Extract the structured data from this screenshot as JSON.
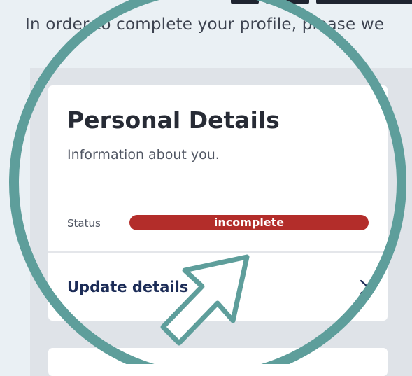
{
  "intro_text": "In order to complete your profile, please we",
  "card": {
    "title": "Personal Details",
    "subtitle": "Information about you.",
    "status_label": "Status",
    "status_value": "incomplete",
    "update_label": "Update details"
  },
  "colors": {
    "background": "#eaf0f4",
    "panel": "#dfe3e8",
    "card": "#ffffff",
    "status_incomplete": "#b32d2a",
    "link": "#1c2c57",
    "highlight_ring": "#5e9e9b"
  },
  "icons": [
    "chevron-right-icon",
    "pointer-arrow-icon"
  ]
}
